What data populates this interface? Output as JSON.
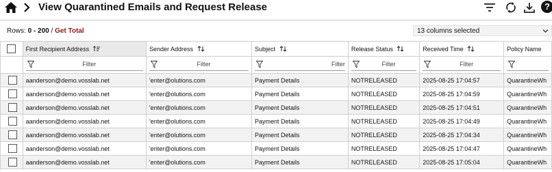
{
  "header": {
    "title": "View Quarantined Emails and Request Release",
    "icons": [
      "home-icon",
      "chevron-right-icon",
      "filter-lines-icon",
      "refresh-icon",
      "download-icon",
      "help-icon"
    ],
    "help_label": "?"
  },
  "toolbar": {
    "rows_label": "Rows:",
    "rows_range": "0 - 200",
    "separator": " / ",
    "get_total_label": "Get Total",
    "columns_selected": "13 columns selected"
  },
  "grid": {
    "columns": [
      {
        "label": "First Recipient Address",
        "sort": "sorted-asc"
      },
      {
        "label": "Sender Address",
        "sort": "unsorted"
      },
      {
        "label": "Subject",
        "sort": "unsorted"
      },
      {
        "label": "Release Status",
        "sort": "unsorted"
      },
      {
        "label": "Received Time",
        "sort": "unsorted"
      },
      {
        "label": "Policy Name",
        "sort": ""
      }
    ],
    "filter_placeholder": "Filter",
    "rows": [
      [
        "aanderson@demo.vosslab.net",
        "'enter@olutions.com",
        "Payment Details",
        "NOTRELEASED",
        "2025-08-25 17:04:57",
        "QuarantineWh"
      ],
      [
        "aanderson@demo.vosslab.net",
        "'enter@olutions.com",
        "Payment Details",
        "NOTRELEASED",
        "2025-08-25 17:04:59",
        "QuarantineWh"
      ],
      [
        "aanderson@demo.vosslab.net",
        "'enter@olutions.com",
        "Payment Details",
        "NOTRELEASED",
        "2025-08-25 17:04:51",
        "QuarantineWh"
      ],
      [
        "aanderson@demo.vosslab.net",
        "'enter@olutions.com",
        "Payment Details",
        "NOTRELEASED",
        "2025-08-25 17:04:49",
        "QuarantineWh"
      ],
      [
        "aanderson@demo.vosslab.net",
        "'enter@olutions.com",
        "Payment Details",
        "NOTRELEASED",
        "2025-08-25 17:04:34",
        "QuarantineWh"
      ],
      [
        "aanderson@demo.vosslab.net",
        "'enter@olutions.com",
        "Payment Details",
        "NOTRELEASED",
        "2025-08-25 17:04:47",
        "QuarantineWh"
      ],
      [
        "aanderson@demo.vosslab.net",
        "'enter@olutions.com",
        "Payment Details",
        "NOTRELEASED",
        "2025-08-25 17:05:04",
        "QuarantineWh"
      ]
    ]
  },
  "colors": {
    "get_total": "#8b1a1a",
    "sorted_header_bg": "#e9e9e9",
    "alt_row_bg": "#f2f2f2"
  }
}
